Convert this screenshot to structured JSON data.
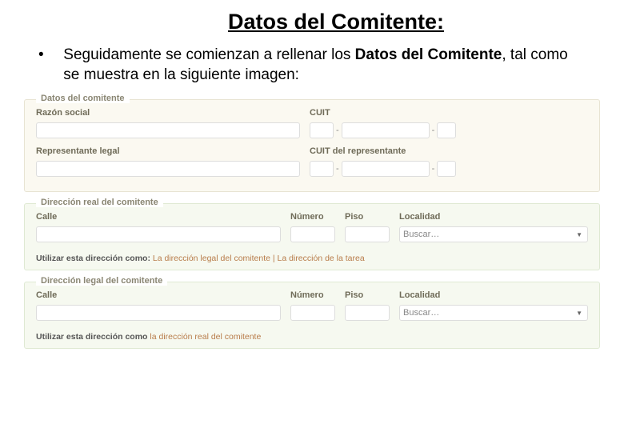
{
  "title": "Datos del Comitente:",
  "intro": {
    "pre": "Seguidamente se comienzan a rellenar los ",
    "bold": "Datos del Comitente",
    "post": ", tal como se muestra en la siguiente imagen:"
  },
  "panel1": {
    "title": "Datos del comitente",
    "razon_label": "Razón social",
    "cuit_label": "CUIT",
    "rep_label": "Representante legal",
    "cuit_rep_label": "CUIT del representante"
  },
  "addr": {
    "calle": "Calle",
    "numero": "Número",
    "piso": "Piso",
    "localidad": "Localidad",
    "buscar": "Buscar…"
  },
  "panel2": {
    "title": "Dirección real del comitente",
    "use_label": "Utilizar esta dirección como:",
    "link1": "La dirección legal del comitente",
    "sep": " | ",
    "link2": "La dirección de la tarea"
  },
  "panel3": {
    "title": "Dirección legal del comitente",
    "use_label": "Utilizar esta dirección como",
    "link1": "la dirección real del comitente"
  }
}
